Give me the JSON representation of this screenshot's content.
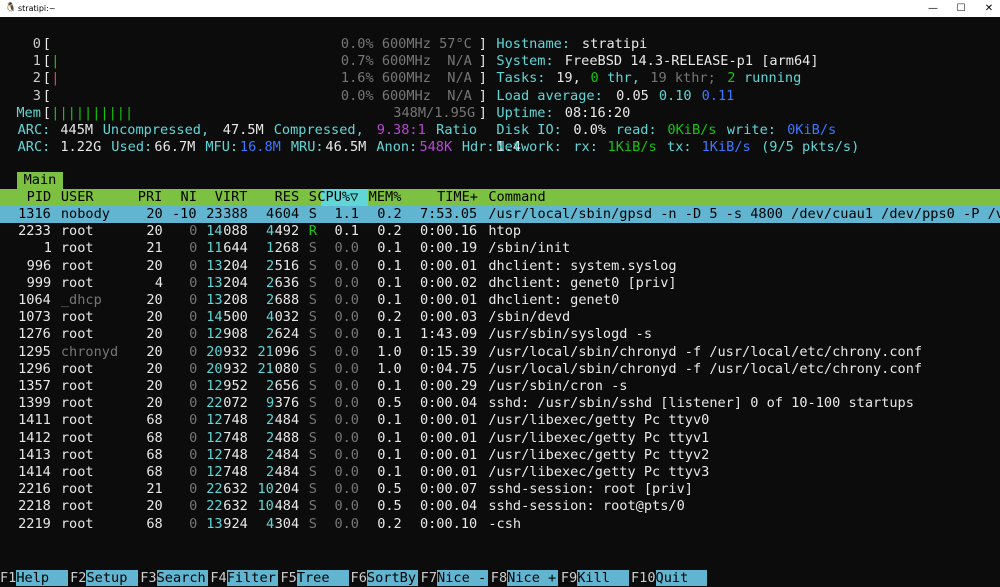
{
  "window": {
    "title": "stratipi:~",
    "icon": "terminal-penguin-icon"
  },
  "meters": {
    "cpus": [
      {
        "id": "0",
        "bar": "",
        "pct": "0.0%",
        "freq": "600MHz",
        "temp": "57°C"
      },
      {
        "id": "1",
        "bar": "|",
        "pct": "0.7%",
        "freq": "600MHz",
        "temp": "N/A"
      },
      {
        "id": "2",
        "bar": "|",
        "pct": "1.6%",
        "freq": "600MHz",
        "temp": "N/A"
      },
      {
        "id": "3",
        "bar": "",
        "pct": "0.0%",
        "freq": "600MHz",
        "temp": "N/A"
      }
    ],
    "mem": {
      "label": "Mem",
      "bar": "||||||||||",
      "value": "348M/1.95G"
    },
    "arc1": {
      "label": "ARC:",
      "size": "445M",
      "uncomp_label": "Uncompressed,",
      "comp": "47.5M",
      "comp_label": "Compressed,",
      "ratio": "9.38:1",
      "ratio_label": "Ratio"
    },
    "arc2": {
      "label": "ARC:",
      "size": "1.22G",
      "used_label": "Used:",
      "used": "66.7M",
      "mfu_label": "MFU:",
      "mfu": "16.8M",
      "mru_label": "MRU:",
      "mru": "46.5M",
      "anon_label": "Anon:",
      "anon": "548K",
      "hdr_label": "Hdr:",
      "hdr": "1.4"
    }
  },
  "info": {
    "hostname_label": "Hostname:",
    "hostname": "stratipi",
    "system_label": "System:",
    "system": "FreeBSD 14.3-RELEASE-p1 [arm64]",
    "tasks_label": "Tasks:",
    "tasks": "19,",
    "thr": "0",
    "thr_label": "thr,",
    "kthr": "19 kthr;",
    "running": "2",
    "running_label": "running",
    "load_label": "Load average:",
    "load1": "0.05",
    "load5": "0.10",
    "load15": "0.11",
    "uptime_label": "Uptime:",
    "uptime": "08:16:20",
    "disk_label": "Disk IO:",
    "disk_pct": "0.0%",
    "read_label": "read:",
    "read": "0KiB/s",
    "write_label": "write:",
    "write": "0KiB/s",
    "net_label": "Network:",
    "rx_label": "rx:",
    "rx": "1KiB/s",
    "tx_label": "tx:",
    "tx": "1KiB/s",
    "pkts": "(9/5 pkts/s)"
  },
  "tab": "Main",
  "columns": [
    "PID",
    "USER",
    "PRI",
    "NI",
    "VIRT",
    "RES",
    "S",
    "CPU%▽",
    "MEM%",
    "TIME+",
    "Command"
  ],
  "processes": [
    {
      "pid": "1316",
      "user": "nobody",
      "pri": "20",
      "ni": "-10",
      "virt": "23388",
      "res": "4604",
      "s": "S",
      "cpu": "1.1",
      "mem": "0.2",
      "time": "7:53.05",
      "cmd": "/usr/local/sbin/gpsd -n -D 5 -s 4800 /dev/cuau1 /dev/pps0 -P /va"
    },
    {
      "pid": "2233",
      "user": "root",
      "pri": "20",
      "ni": "0",
      "virt": "14088",
      "res": "4492",
      "s": "R",
      "cpu": "0.1",
      "mem": "0.2",
      "time": "0:00.16",
      "cmd": "htop"
    },
    {
      "pid": "1",
      "user": "root",
      "pri": "21",
      "ni": "0",
      "virt": "11644",
      "res": "1268",
      "s": "S",
      "cpu": "0.0",
      "mem": "0.1",
      "time": "0:00.19",
      "cmd": "/sbin/init"
    },
    {
      "pid": "996",
      "user": "root",
      "pri": "20",
      "ni": "0",
      "virt": "13204",
      "res": "2516",
      "s": "S",
      "cpu": "0.0",
      "mem": "0.1",
      "time": "0:00.01",
      "cmd": "dhclient: system.syslog"
    },
    {
      "pid": "999",
      "user": "root",
      "pri": "4",
      "ni": "0",
      "virt": "13204",
      "res": "2636",
      "s": "S",
      "cpu": "0.0",
      "mem": "0.1",
      "time": "0:00.02",
      "cmd": "dhclient: genet0 [priv]"
    },
    {
      "pid": "1064",
      "user": "_dhcp",
      "pri": "20",
      "ni": "0",
      "virt": "13208",
      "res": "2688",
      "s": "S",
      "cpu": "0.0",
      "mem": "0.1",
      "time": "0:00.01",
      "cmd": "dhclient: genet0"
    },
    {
      "pid": "1073",
      "user": "root",
      "pri": "20",
      "ni": "0",
      "virt": "14500",
      "res": "4032",
      "s": "S",
      "cpu": "0.0",
      "mem": "0.2",
      "time": "0:00.03",
      "cmd": "/sbin/devd"
    },
    {
      "pid": "1276",
      "user": "root",
      "pri": "20",
      "ni": "0",
      "virt": "12908",
      "res": "2624",
      "s": "S",
      "cpu": "0.0",
      "mem": "0.1",
      "time": "1:43.09",
      "cmd": "/usr/sbin/syslogd -s"
    },
    {
      "pid": "1295",
      "user": "chronyd",
      "pri": "20",
      "ni": "0",
      "virt": "20932",
      "res": "21096",
      "s": "S",
      "cpu": "0.0",
      "mem": "1.0",
      "time": "0:15.39",
      "cmd": "/usr/local/sbin/chronyd -f /usr/local/etc/chrony.conf"
    },
    {
      "pid": "1296",
      "user": "root",
      "pri": "20",
      "ni": "0",
      "virt": "20932",
      "res": "21080",
      "s": "S",
      "cpu": "0.0",
      "mem": "1.0",
      "time": "0:04.75",
      "cmd": "/usr/local/sbin/chronyd -f /usr/local/etc/chrony.conf"
    },
    {
      "pid": "1357",
      "user": "root",
      "pri": "20",
      "ni": "0",
      "virt": "12952",
      "res": "2656",
      "s": "S",
      "cpu": "0.0",
      "mem": "0.1",
      "time": "0:00.29",
      "cmd": "/usr/sbin/cron -s"
    },
    {
      "pid": "1399",
      "user": "root",
      "pri": "20",
      "ni": "0",
      "virt": "22072",
      "res": "9376",
      "s": "S",
      "cpu": "0.0",
      "mem": "0.5",
      "time": "0:00.04",
      "cmd": "sshd: /usr/sbin/sshd [listener] 0 of 10-100 startups"
    },
    {
      "pid": "1411",
      "user": "root",
      "pri": "68",
      "ni": "0",
      "virt": "12748",
      "res": "2484",
      "s": "S",
      "cpu": "0.0",
      "mem": "0.1",
      "time": "0:00.01",
      "cmd": "/usr/libexec/getty Pc ttyv0"
    },
    {
      "pid": "1412",
      "user": "root",
      "pri": "68",
      "ni": "0",
      "virt": "12748",
      "res": "2488",
      "s": "S",
      "cpu": "0.0",
      "mem": "0.1",
      "time": "0:00.01",
      "cmd": "/usr/libexec/getty Pc ttyv1"
    },
    {
      "pid": "1413",
      "user": "root",
      "pri": "68",
      "ni": "0",
      "virt": "12748",
      "res": "2484",
      "s": "S",
      "cpu": "0.0",
      "mem": "0.1",
      "time": "0:00.01",
      "cmd": "/usr/libexec/getty Pc ttyv2"
    },
    {
      "pid": "1414",
      "user": "root",
      "pri": "68",
      "ni": "0",
      "virt": "12748",
      "res": "2484",
      "s": "S",
      "cpu": "0.0",
      "mem": "0.1",
      "time": "0:00.01",
      "cmd": "/usr/libexec/getty Pc ttyv3"
    },
    {
      "pid": "2216",
      "user": "root",
      "pri": "21",
      "ni": "0",
      "virt": "22632",
      "res": "10204",
      "s": "S",
      "cpu": "0.0",
      "mem": "0.5",
      "time": "0:00.07",
      "cmd": "sshd-session: root [priv]"
    },
    {
      "pid": "2218",
      "user": "root",
      "pri": "20",
      "ni": "0",
      "virt": "22632",
      "res": "10484",
      "s": "S",
      "cpu": "0.0",
      "mem": "0.5",
      "time": "0:00.04",
      "cmd": "sshd-session: root@pts/0"
    },
    {
      "pid": "2219",
      "user": "root",
      "pri": "68",
      "ni": "0",
      "virt": "13924",
      "res": "4304",
      "s": "S",
      "cpu": "0.0",
      "mem": "0.2",
      "time": "0:00.10",
      "cmd": "-csh"
    }
  ],
  "footer": [
    {
      "key": "F1",
      "label": "Help"
    },
    {
      "key": "F2",
      "label": "Setup"
    },
    {
      "key": "F3",
      "label": "Search"
    },
    {
      "key": "F4",
      "label": "Filter"
    },
    {
      "key": "F5",
      "label": "Tree"
    },
    {
      "key": "F6",
      "label": "SortBy"
    },
    {
      "key": "F7",
      "label": "Nice -"
    },
    {
      "key": "F8",
      "label": "Nice +"
    },
    {
      "key": "F9",
      "label": "Kill"
    },
    {
      "key": "F10",
      "label": "Quit"
    }
  ],
  "colors": {
    "header_bar": "#7cc142",
    "selected_row": "#61b5d0",
    "cyan": "#61d6d6",
    "blue": "#3b78ff",
    "magenta": "#b847d4"
  }
}
